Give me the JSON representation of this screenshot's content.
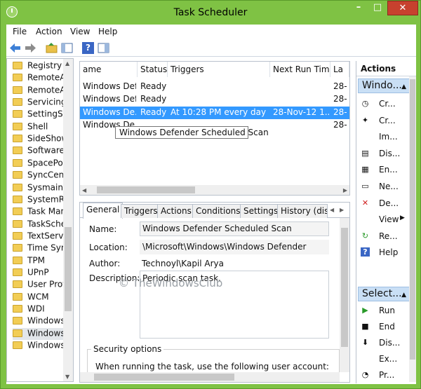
{
  "window": {
    "title": "Task Scheduler"
  },
  "menu": [
    "File",
    "Action",
    "View",
    "Help"
  ],
  "toolbar": {
    "help_label": "?"
  },
  "tree": {
    "items": [
      "Registry",
      "RemoteApp",
      "RemoteAs",
      "Servicing",
      "SettingSync",
      "Shell",
      "SideShow",
      "SoftwareP",
      "SpacePort",
      "SyncCent",
      "Sysmain",
      "SystemRe",
      "Task Man",
      "TaskSched",
      "TextServic",
      "Time Sync",
      "TPM",
      "UPnP",
      "User Profi",
      "WCM",
      "WDI",
      "Windows",
      "Windows",
      "Windows"
    ],
    "selected_index": 22
  },
  "tasks": {
    "columns": [
      "ame",
      "Status",
      "Triggers",
      "Next Run Time",
      "La"
    ],
    "rows": [
      {
        "name": "Windows Defe",
        "status": "Ready",
        "triggers": "",
        "next": "",
        "last": "28-"
      },
      {
        "name": "Windows Defe",
        "status": "Ready",
        "triggers": "",
        "next": "",
        "last": "28-"
      },
      {
        "name": "Windows De...",
        "status": "Ready",
        "triggers": "At 10:28 PM every day",
        "next": "28-Nov-12 1...",
        "last": "28-"
      },
      {
        "name": "Windows De...",
        "status": "",
        "triggers": "",
        "next": "",
        "last": "28-"
      }
    ],
    "selected_index": 2,
    "tooltip": "Windows Defender Scheduled Scan"
  },
  "detail": {
    "tabs": [
      "General",
      "Triggers",
      "Actions",
      "Conditions",
      "Settings",
      "History (dis"
    ],
    "active_tab": 0,
    "name_label": "Name:",
    "name_value": "Windows Defender Scheduled Scan",
    "location_label": "Location:",
    "location_value": "\\Microsoft\\Windows\\Windows Defender",
    "author_label": "Author:",
    "author_value": "Technoyl\\Kapil Arya",
    "description_label": "Description:",
    "description_value": "Periodic scan task.",
    "security_title": "Security options",
    "security_text": "When running the task, use the following user account:"
  },
  "watermark": "TheWindowsClub",
  "actions": {
    "header": "Actions",
    "group1": "Windo...",
    "group1_items": [
      {
        "icon": "create-basic-task-icon",
        "glyph": "◷",
        "label": "Cr..."
      },
      {
        "icon": "create-task-icon",
        "glyph": "✦",
        "label": "Cr..."
      },
      {
        "icon": "import-task-icon",
        "glyph": "",
        "label": "Im..."
      },
      {
        "icon": "display-running-icon",
        "glyph": "▤",
        "label": "Dis..."
      },
      {
        "icon": "enable-history-icon",
        "glyph": "▦",
        "label": "En..."
      },
      {
        "icon": "new-folder-icon",
        "glyph": "▭",
        "label": "Ne..."
      },
      {
        "icon": "delete-folder-icon",
        "glyph": "✕",
        "label": "De..."
      },
      {
        "icon": "view-icon",
        "glyph": "",
        "label": "View"
      },
      {
        "icon": "refresh-icon",
        "glyph": "↻",
        "label": "Re..."
      },
      {
        "icon": "help-icon",
        "glyph": "?",
        "label": "Help"
      }
    ],
    "group2": "Select...",
    "group2_items": [
      {
        "icon": "run-icon",
        "glyph": "▶",
        "label": "Run"
      },
      {
        "icon": "end-icon",
        "glyph": "■",
        "label": "End"
      },
      {
        "icon": "disable-icon",
        "glyph": "⬇",
        "label": "Dis..."
      },
      {
        "icon": "export-icon",
        "glyph": "",
        "label": "Ex..."
      },
      {
        "icon": "properties-icon",
        "glyph": "◔",
        "label": "Pr..."
      }
    ]
  },
  "colors": {
    "title_bar": "#7fc244",
    "selection": "#3399ff",
    "close_button": "#c7412e",
    "group_header": "#c9dff5"
  }
}
